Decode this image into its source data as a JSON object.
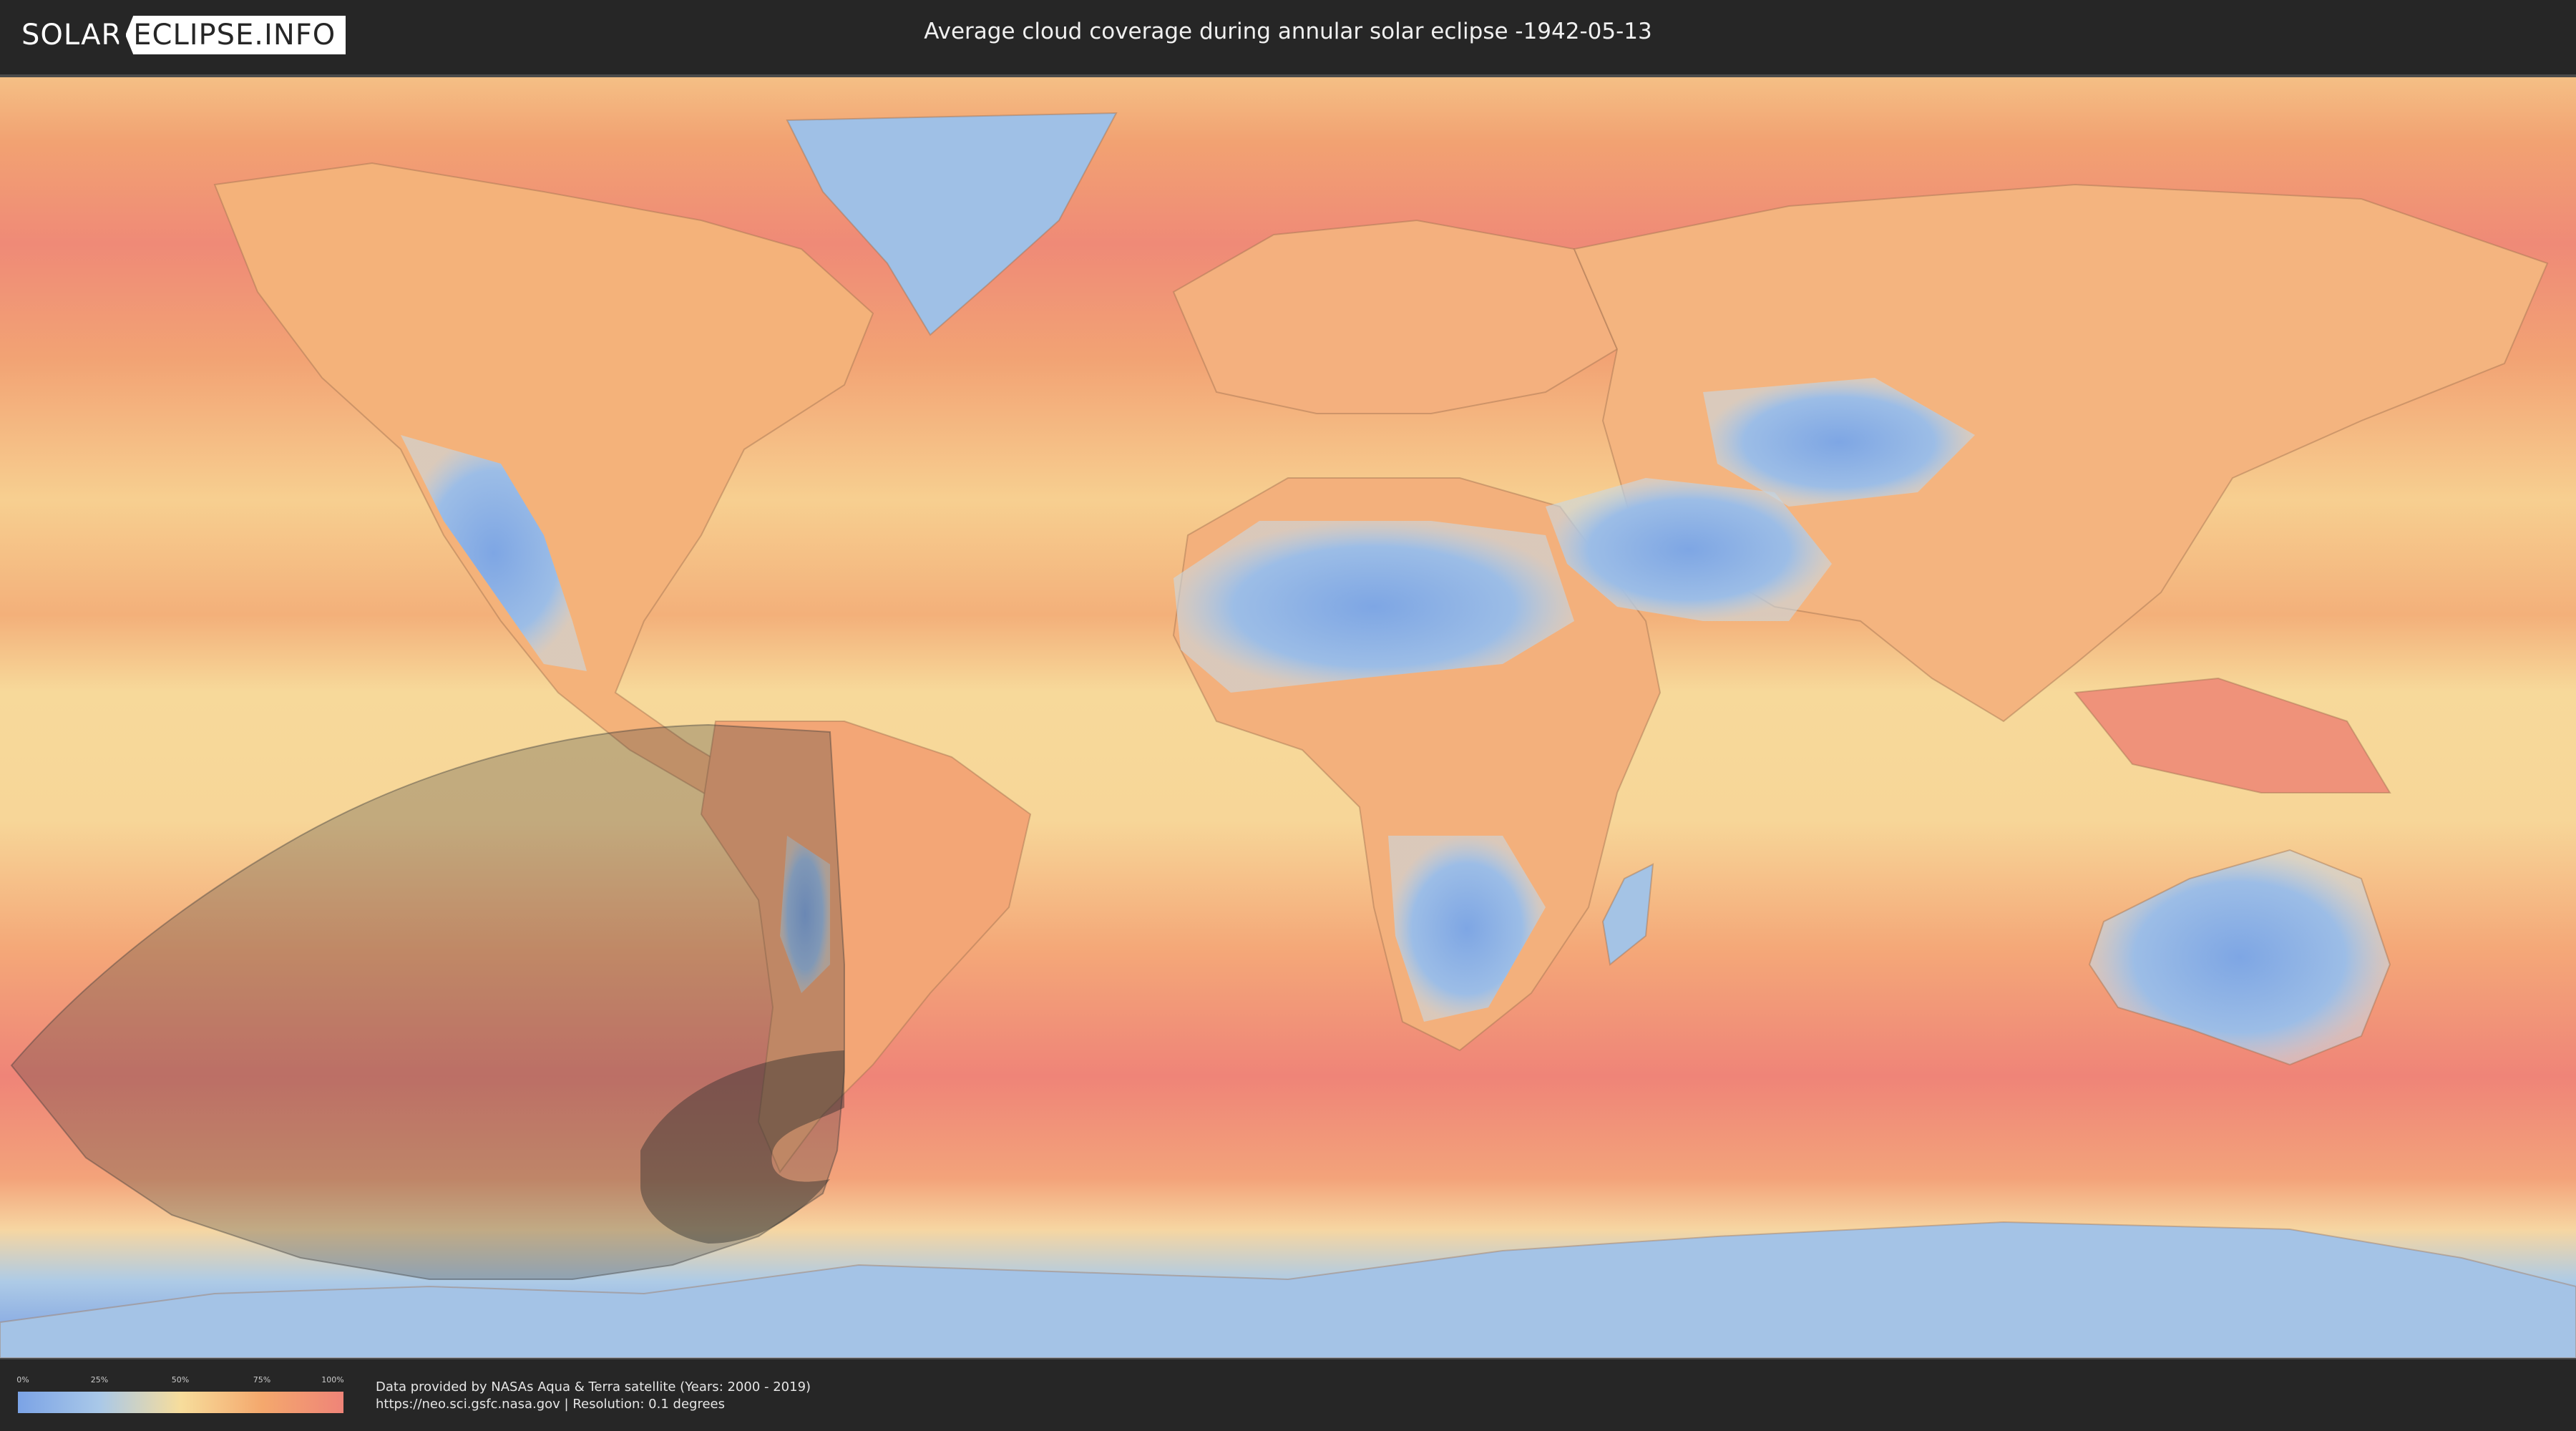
{
  "header": {
    "logo_left": "SOLAR",
    "logo_right": "ECLIPSE.INFO",
    "title": "Average cloud coverage during annular solar eclipse -1942-05-13"
  },
  "map": {
    "type": "cloud-coverage-world-map",
    "eclipse_type": "annular",
    "eclipse_date": "-1942-05-13",
    "colors": {
      "clear": "#7ba3e6",
      "low": "#a9c8e8",
      "mid": "#f7dd9c",
      "high": "#f4a86d",
      "overcast": "#ef8478",
      "eclipse_shade": "#3a3a3a"
    }
  },
  "legend": {
    "ticks": [
      "0%",
      "25%",
      "50%",
      "75%",
      "100%"
    ]
  },
  "footer": {
    "credit_line1": "Data provided by NASAs Aqua & Terra satellite (Years: 2000 - 2019)",
    "credit_line2": "https://neo.sci.gsfc.nasa.gov | Resolution: 0.1 degrees"
  }
}
